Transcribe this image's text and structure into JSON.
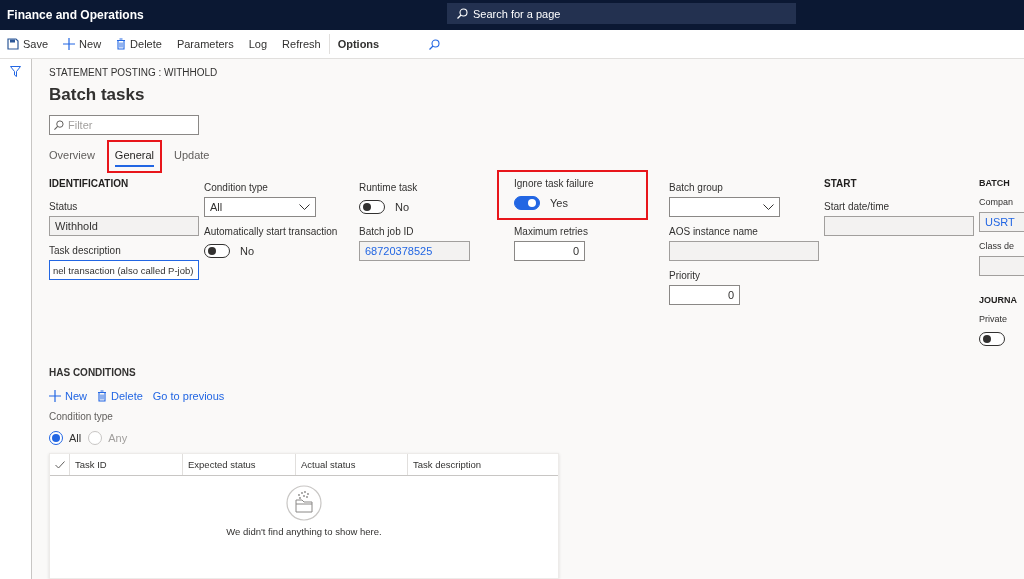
{
  "app": {
    "title": "Finance and Operations",
    "search_placeholder": "Search for a page"
  },
  "toolbar": [
    {
      "kind": "save",
      "label": "Save"
    },
    {
      "kind": "new",
      "label": "New"
    },
    {
      "kind": "delete",
      "label": "Delete"
    },
    {
      "kind": "text",
      "label": "Parameters"
    },
    {
      "kind": "text",
      "label": "Log"
    },
    {
      "kind": "text",
      "label": "Refresh"
    },
    {
      "kind": "options",
      "label": "Options"
    },
    {
      "kind": "search"
    }
  ],
  "page": {
    "breadcrumb": "STATEMENT POSTING : WITHHOLD",
    "title": "Batch tasks",
    "filter_placeholder": "Filter"
  },
  "tabs": [
    {
      "label": "Overview",
      "selected": false,
      "highlighted": false
    },
    {
      "label": "General",
      "selected": true,
      "highlighted": true
    },
    {
      "label": "Update",
      "selected": false,
      "highlighted": false
    }
  ],
  "columns": [
    [
      {
        "kind": "heading",
        "text": "IDENTIFICATION"
      },
      {
        "kind": "readonly",
        "label": "Status",
        "value": "Withhold"
      },
      {
        "kind": "input",
        "label": "Task description",
        "value": "nel transaction (also called P-job)",
        "focused": true
      }
    ],
    [
      {
        "kind": "select",
        "label": "Condition type",
        "value": "All"
      },
      {
        "kind": "toggle",
        "label": "Automatically start transaction",
        "on": false,
        "state": "No"
      }
    ],
    [
      {
        "kind": "toggle",
        "label": "Runtime task",
        "on": false,
        "state": "No"
      },
      {
        "kind": "readonly",
        "label": "Batch job ID",
        "value": "68720378525",
        "link": true
      }
    ],
    [
      {
        "kind": "toggle",
        "label": "Ignore task failure",
        "on": true,
        "state": "Yes",
        "highlighted": true
      },
      {
        "kind": "number",
        "label": "Maximum retries",
        "value": "0"
      }
    ],
    [
      {
        "kind": "select",
        "label": "Batch group"
      },
      {
        "kind": "readonly",
        "label": "AOS instance name"
      },
      {
        "kind": "number",
        "label": "Priority",
        "value": "0"
      }
    ],
    [
      {
        "kind": "heading",
        "text": "START"
      },
      {
        "kind": "readonly",
        "label": "Start date/time"
      }
    ],
    [
      {
        "kind": "heading",
        "text": "BATCH"
      },
      {
        "kind": "readonly",
        "label": "Compan",
        "value": "USRT",
        "link": true
      },
      {
        "kind": "readonly",
        "label": "Class de"
      },
      {
        "kind": "heading",
        "text": "JOURNA"
      },
      {
        "kind": "toggle",
        "label": "Private",
        "on": false
      }
    ]
  ],
  "conditions": {
    "heading": "HAS CONDITIONS",
    "actions": [
      {
        "kind": "new",
        "label": "New"
      },
      {
        "kind": "delete",
        "label": "Delete"
      },
      {
        "kind": "text",
        "label": "Go to previous"
      }
    ],
    "condition_type_label": "Condition type",
    "options": [
      {
        "label": "All",
        "selected": true
      },
      {
        "label": "Any",
        "selected": false
      }
    ],
    "grid_columns": [
      "Task ID",
      "Expected status",
      "Actual status",
      "Task description"
    ],
    "empty_message": "We didn't find anything to show here."
  }
}
